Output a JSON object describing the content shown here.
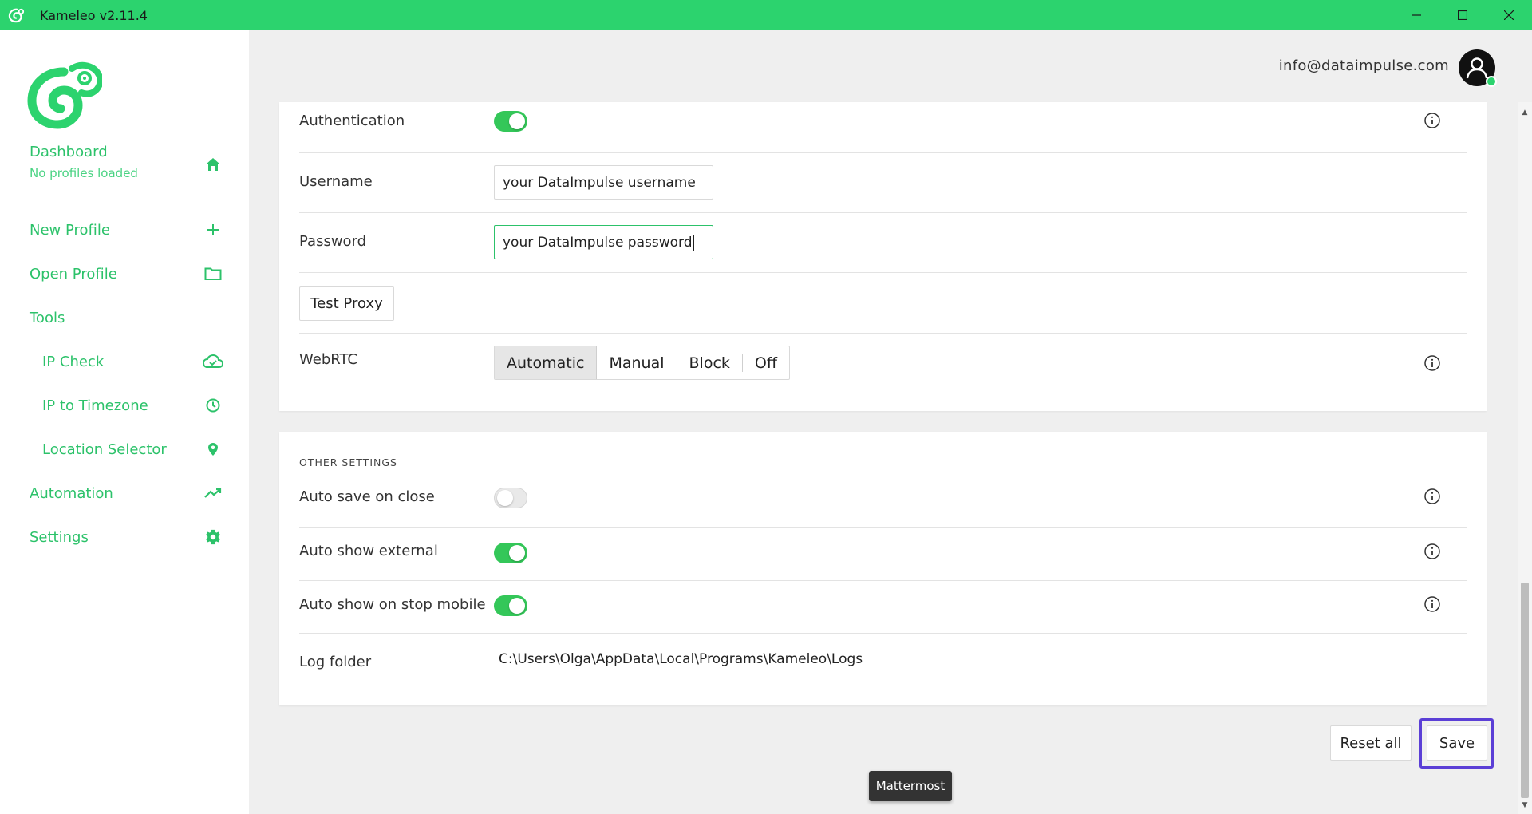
{
  "window": {
    "title": "Kameleo v2.11.4"
  },
  "header": {
    "email": "info@dataimpulse.com"
  },
  "sidebar": {
    "dashboard": {
      "label": "Dashboard",
      "sub": "No profiles loaded"
    },
    "new_profile": "New Profile",
    "open_profile": "Open Profile",
    "tools": "Tools",
    "ip_check": "IP Check",
    "ip_to_timezone": "IP to Timezone",
    "location_selector": "Location Selector",
    "automation": "Automation",
    "settings": "Settings"
  },
  "proxy": {
    "authentication_label": "Authentication",
    "authentication_on": true,
    "username_label": "Username",
    "username_value": "your DataImpulse username",
    "password_label": "Password",
    "password_value": "your DataImpulse password",
    "test_proxy": "Test Proxy",
    "webrtc_label": "WebRTC",
    "webrtc_options": [
      "Automatic",
      "Manual",
      "Block",
      "Off"
    ],
    "webrtc_selected": "Automatic"
  },
  "other_settings": {
    "title": "OTHER SETTINGS",
    "auto_save_label": "Auto save on close",
    "auto_save_on": false,
    "auto_show_external_label": "Auto show external",
    "auto_show_external_on": true,
    "auto_show_stop_mobile_label": "Auto show on stop mobile",
    "auto_show_stop_mobile_on": true,
    "log_folder_label": "Log folder",
    "log_folder_value": "C:\\Users\\Olga\\AppData\\Local\\Programs\\Kameleo\\Logs"
  },
  "actions": {
    "reset_all": "Reset all",
    "save": "Save"
  },
  "tooltip": {
    "text": "Mattermost"
  },
  "colors": {
    "brand": "#2cd36e",
    "nav_text": "#2cc26a",
    "toggle_on": "#34c759",
    "focus_outline": "#5b3fd6"
  }
}
